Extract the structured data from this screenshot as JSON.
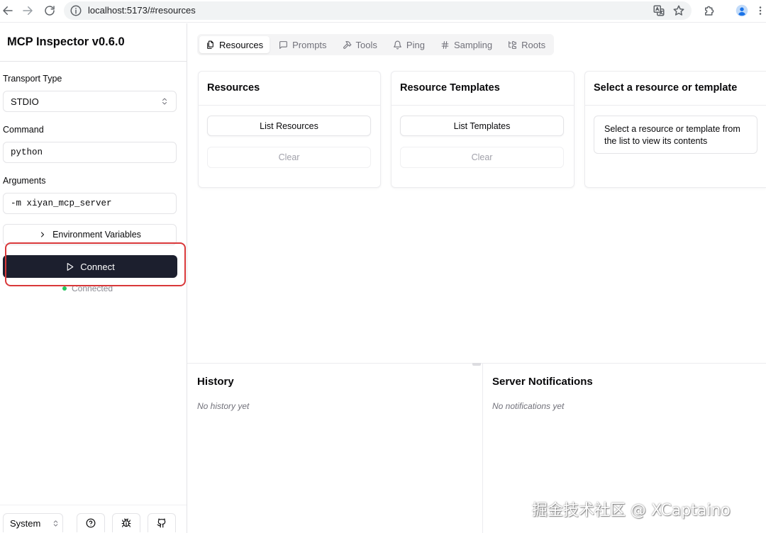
{
  "browser": {
    "url": "localhost:5173/#resources",
    "icons": [
      "back-arrow-icon",
      "forward-arrow-icon",
      "reload-icon",
      "site-info-icon",
      "translate-icon",
      "bookmark-star-icon",
      "extensions-icon",
      "profile-avatar-icon",
      "more-menu-icon"
    ]
  },
  "sidebar": {
    "title": "MCP Inspector v0.6.0",
    "transport": {
      "label": "Transport Type",
      "value": "STDIO",
      "icon": "chevrons-up-down-icon"
    },
    "command": {
      "label": "Command",
      "value": "python"
    },
    "arguments": {
      "label": "Arguments",
      "value": "-m xiyan_mcp_server"
    },
    "env_toggle": {
      "label": "Environment Variables",
      "icon": "chevron-right-icon"
    },
    "connect": {
      "label": "Connect",
      "icon": "play-icon"
    },
    "status": {
      "text": "Connected"
    },
    "footer": {
      "theme": "System",
      "icons": [
        "help-icon",
        "bug-icon",
        "github-icon"
      ]
    }
  },
  "tabs": [
    {
      "label": "Resources",
      "icon": "files-icon",
      "active": true
    },
    {
      "label": "Prompts",
      "icon": "message-icon",
      "active": false
    },
    {
      "label": "Tools",
      "icon": "hammer-icon",
      "active": false
    },
    {
      "label": "Ping",
      "icon": "bell-icon",
      "active": false
    },
    {
      "label": "Sampling",
      "icon": "hash-icon",
      "active": false
    },
    {
      "label": "Roots",
      "icon": "folder-tree-icon",
      "active": false
    }
  ],
  "resources_panel": {
    "title": "Resources",
    "list_button": "List Resources",
    "clear_button": "Clear"
  },
  "templates_panel": {
    "title": "Resource Templates",
    "list_button": "List Templates",
    "clear_button": "Clear"
  },
  "detail_panel": {
    "title": "Select a resource or template",
    "placeholder": "Select a resource or template from the list to view its contents"
  },
  "history": {
    "title": "History",
    "empty": "No history yet"
  },
  "notifications": {
    "title": "Server Notifications",
    "empty": "No notifications yet"
  },
  "colors": {
    "connect_bg": "#1c1f2e",
    "annotation": "#d9383a",
    "status_dot": "#22c55e",
    "tab_bar_bg": "#f4f4f5"
  },
  "watermark": "掘金技术社区 @ XCaptaino"
}
